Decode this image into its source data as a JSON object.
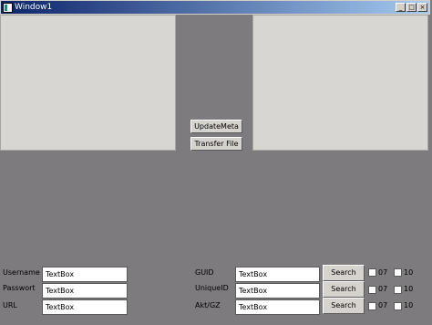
{
  "window": {
    "title": "Window1",
    "controls": {
      "minimize": "_",
      "maximize": "□",
      "close": "×"
    }
  },
  "center_buttons": {
    "update_meta": "UpdateMeta",
    "transfer_file": "Transfer File"
  },
  "left_form": {
    "rows": [
      {
        "label": "Username",
        "value": "TextBox"
      },
      {
        "label": "Passwort",
        "value": "TextBox"
      },
      {
        "label": "URL",
        "value": "TextBox"
      }
    ]
  },
  "right_form": {
    "rows": [
      {
        "label": "GUID",
        "value": "TextBox",
        "search": "Search",
        "cb1": "07",
        "cb2": "10"
      },
      {
        "label": "UniqueID",
        "value": "TextBox",
        "search": "Search",
        "cb1": "07",
        "cb2": "10"
      },
      {
        "label": "Akt/GZ",
        "value": "TextBox",
        "search": "Search",
        "cb1": "07",
        "cb2": "10"
      }
    ]
  }
}
